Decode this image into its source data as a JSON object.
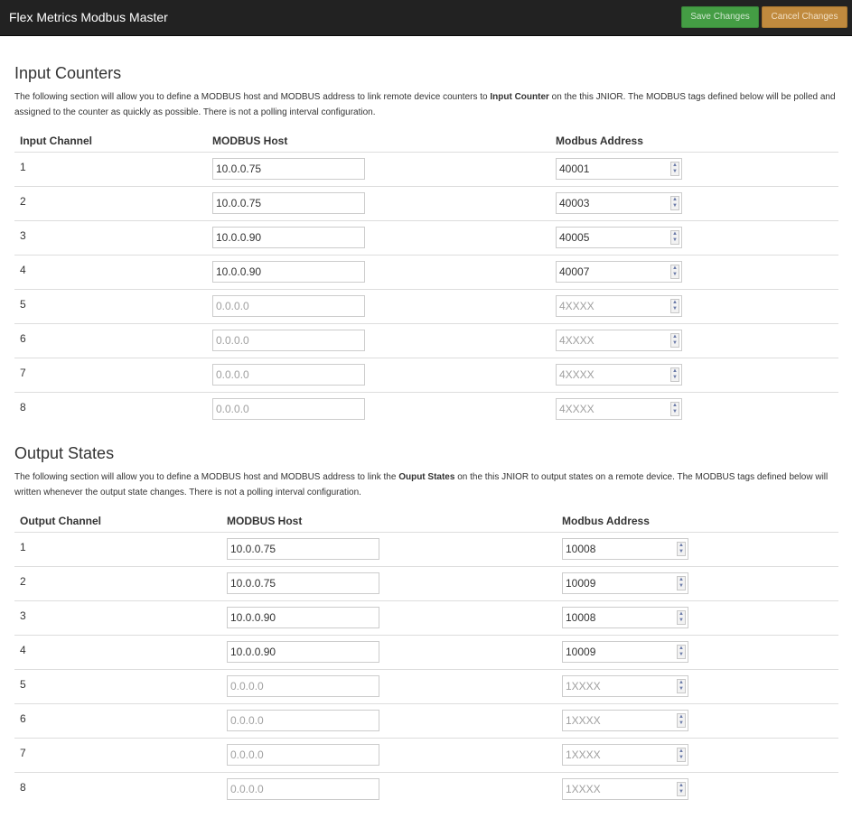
{
  "navbar": {
    "title": "Flex Metrics Modbus Master",
    "save_label": "Save Changes",
    "cancel_label": "Cancel Changes"
  },
  "input_section": {
    "title": "Input Counters",
    "desc_1": "The following section will allow you to define a MODBUS host and MODBUS address to link remote device counters to ",
    "desc_bold": "Input Counter",
    "desc_2": " on the this JNIOR. The MODBUS tags defined below will be polled and assigned to the counter as quickly as possible. There is not a polling interval configuration.",
    "columns": [
      "Input Channel",
      "MODBUS Host",
      "Modbus Address"
    ],
    "host_placeholder": "0.0.0.0",
    "address_placeholder": "4XXXX",
    "rows": [
      {
        "channel": "1",
        "host": "10.0.0.75",
        "address": "40001"
      },
      {
        "channel": "2",
        "host": "10.0.0.75",
        "address": "40003"
      },
      {
        "channel": "3",
        "host": "10.0.0.90",
        "address": "40005"
      },
      {
        "channel": "4",
        "host": "10.0.0.90",
        "address": "40007"
      },
      {
        "channel": "5",
        "host": "",
        "address": ""
      },
      {
        "channel": "6",
        "host": "",
        "address": ""
      },
      {
        "channel": "7",
        "host": "",
        "address": ""
      },
      {
        "channel": "8",
        "host": "",
        "address": ""
      }
    ]
  },
  "output_section": {
    "title": "Output States",
    "desc_1": "The following section will allow you to define a MODBUS host and MODBUS address to link the ",
    "desc_bold": "Ouput States",
    "desc_2": " on the this JNIOR to output states on a remote device. The MODBUS tags defined below will written whenever the output state changes. There is not a polling interval configuration.",
    "columns": [
      "Output Channel",
      "MODBUS Host",
      "Modbus Address"
    ],
    "host_placeholder": "0.0.0.0",
    "address_placeholder": "1XXXX",
    "rows": [
      {
        "channel": "1",
        "host": "10.0.0.75",
        "address": "10008"
      },
      {
        "channel": "2",
        "host": "10.0.0.75",
        "address": "10009"
      },
      {
        "channel": "3",
        "host": "10.0.0.90",
        "address": "10008"
      },
      {
        "channel": "4",
        "host": "10.0.0.90",
        "address": "10009"
      },
      {
        "channel": "5",
        "host": "",
        "address": ""
      },
      {
        "channel": "6",
        "host": "",
        "address": ""
      },
      {
        "channel": "7",
        "host": "",
        "address": ""
      },
      {
        "channel": "8",
        "host": "",
        "address": ""
      }
    ]
  },
  "icons": {
    "spin_up": "spinner-up-arrow-icon",
    "spin_down": "spinner-down-arrow-icon"
  },
  "colors": {
    "navbar_bg": "#222222",
    "save_button": "#449d44",
    "cancel_button": "#c08a3e"
  }
}
